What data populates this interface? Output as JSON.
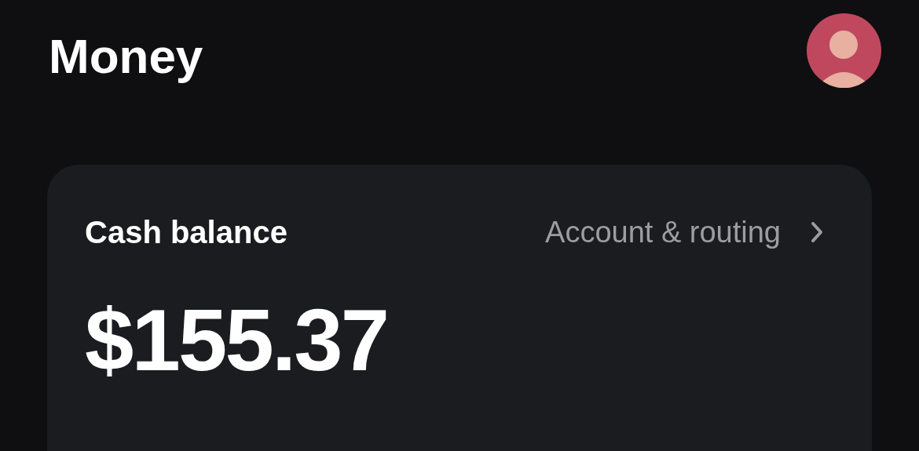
{
  "header": {
    "title": "Money"
  },
  "balance_card": {
    "label": "Cash balance",
    "link": "Account & routing",
    "amount": "$155.37"
  }
}
